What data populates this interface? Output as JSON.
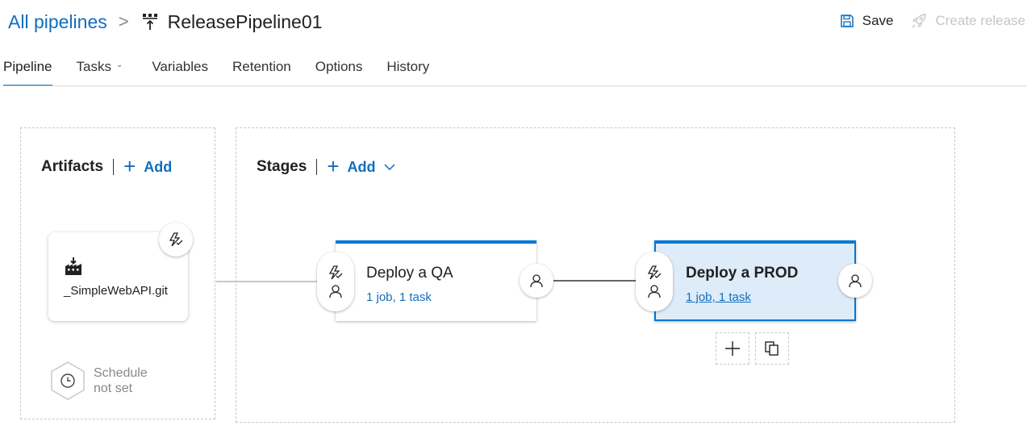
{
  "header": {
    "breadcrumb_root": "All pipelines",
    "breadcrumb_separator": ">",
    "pipeline_name": "ReleasePipeline01",
    "save_label": "Save",
    "create_release_label": "Create release"
  },
  "tabs": [
    {
      "label": "Pipeline",
      "active": true
    },
    {
      "label": "Tasks",
      "has_dropdown": true
    },
    {
      "label": "Variables"
    },
    {
      "label": "Retention"
    },
    {
      "label": "Options"
    },
    {
      "label": "History"
    }
  ],
  "artifacts": {
    "title": "Artifacts",
    "add_label": "Add",
    "items": [
      {
        "name": "_SimpleWebAPI.git",
        "icon": "build-artifact-icon"
      }
    ],
    "schedule": {
      "line1": "Schedule",
      "line2": "not set"
    }
  },
  "stages": {
    "title": "Stages",
    "add_label": "Add",
    "items": [
      {
        "name": "Deploy a QA",
        "summary": "1 job, 1 task",
        "selected": false
      },
      {
        "name": "Deploy a PROD",
        "summary": "1 job, 1 task",
        "selected": true
      }
    ]
  },
  "colors": {
    "accent": "#0078d4",
    "link": "#106ebe",
    "selected_stage_bg": "#deecf9",
    "disabled": "#c8c6c4"
  }
}
